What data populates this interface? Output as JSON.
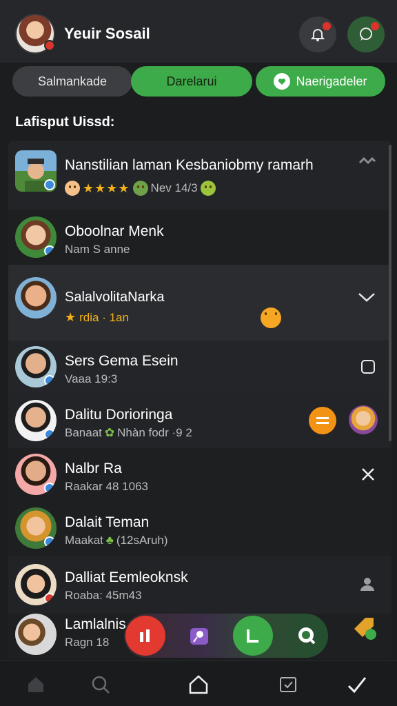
{
  "header": {
    "title": "Yeuir Sosail",
    "avatar_icon": "user-avatar",
    "bell_icon": "bell-icon",
    "chat_icon": "chat-bubble-icon",
    "colors": {
      "bg": "#26272a",
      "accent": "#3eab4a",
      "notification": "#e0322b"
    }
  },
  "tabs": [
    {
      "label": "Salmankade"
    },
    {
      "label": "Darelarui"
    },
    {
      "label": "Naerigadeler",
      "icon": "heart-bubble-icon"
    }
  ],
  "section_title": "Lafisput Uissd:",
  "list": [
    {
      "name": "Nanstilian laman Kesbaniobmy ramarh",
      "sub": "Nev 14/3",
      "stars": "★★★★",
      "action_icon": "link-icon"
    },
    {
      "name": "Oboolnar Menk",
      "sub": "Nam S anne"
    },
    {
      "name": "SalalvolitaNarka",
      "sub": "rdia · 1an",
      "action_icon": "chevron-down-icon"
    },
    {
      "name": "Sers Gema Esein",
      "sub": "Vaaa 19:3",
      "action_icon": "square-icon"
    },
    {
      "name": "Dalitu Dorioringa",
      "sub": "Banaat",
      "sub2": "Nhàn fodr ·9 2",
      "action_icon": "equals-icon"
    },
    {
      "name": "Nalbr Ra",
      "sub": "Raakar 48 1063",
      "action_icon": "close-icon"
    },
    {
      "name": "Dalait Teman",
      "sub": "Maakat",
      "sub2": "(12sAruh)"
    },
    {
      "name": "Dalliat Eemleoknsk",
      "sub": "Roaba: 45m43",
      "action_icon": "user-icon"
    },
    {
      "name": "Lamlalnis",
      "sub": "Ragn 18"
    }
  ],
  "dock": [
    {
      "icon": "bar-chart-icon"
    },
    {
      "icon": "pin-icon"
    },
    {
      "icon": "edit-icon"
    },
    {
      "icon": "search-icon"
    }
  ],
  "bottom_nav": [
    {
      "icon": "home-icon"
    },
    {
      "icon": "search-icon"
    },
    {
      "icon": "house-outline-icon"
    },
    {
      "icon": "calendar-check-icon"
    },
    {
      "icon": "check-icon"
    }
  ]
}
